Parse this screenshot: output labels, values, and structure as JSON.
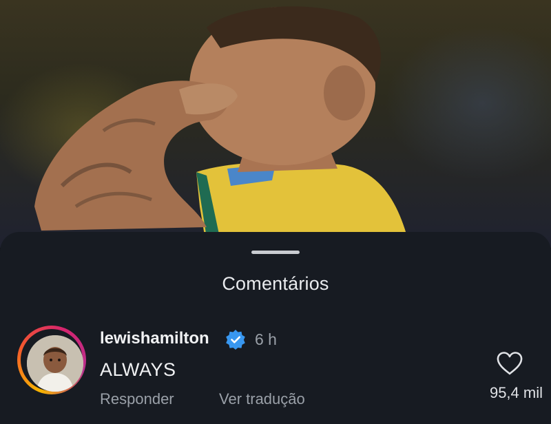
{
  "sheet": {
    "title": "Comentários"
  },
  "comment": {
    "username": "lewishamilton",
    "verified_icon": "verified-badge-icon",
    "time": "6 h",
    "text": "ALWAYS",
    "reply_label": "Responder",
    "translate_label": "Ver tradução",
    "like_icon": "heart-icon",
    "like_count": "95,4 mil"
  },
  "colors": {
    "sheet_background": "#171b22",
    "verified_blue": "#3897f0",
    "secondary_text": "#9aa0a8"
  }
}
